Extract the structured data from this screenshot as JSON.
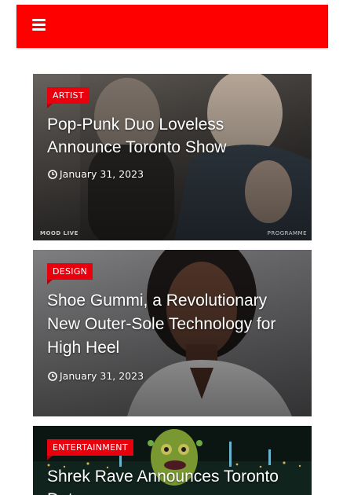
{
  "header": {
    "menu_icon": "hamburger-menu-icon",
    "background_color": "#ff0000"
  },
  "articles": [
    {
      "category": "ARTIST",
      "title": "Pop-Punk Duo Loveless Announce Toronto Show",
      "date": "January 31, 2023",
      "date_icon": "clock-icon",
      "watermark_left": "MOOD LIVE",
      "watermark_right": "PROGRAMME"
    },
    {
      "category": "DESIGN",
      "title": "Shoe Gummi, a Revolutionary New Outer-Sole Technology for High Heel",
      "date": "January 31, 2023",
      "date_icon": "clock-icon"
    },
    {
      "category": "ENTERTAINMENT",
      "title": "Shrek Rave Announces Toronto Dates"
    }
  ],
  "colors": {
    "accent": "#ff0000",
    "badge": "#e8000d",
    "text": "#ffffff"
  }
}
